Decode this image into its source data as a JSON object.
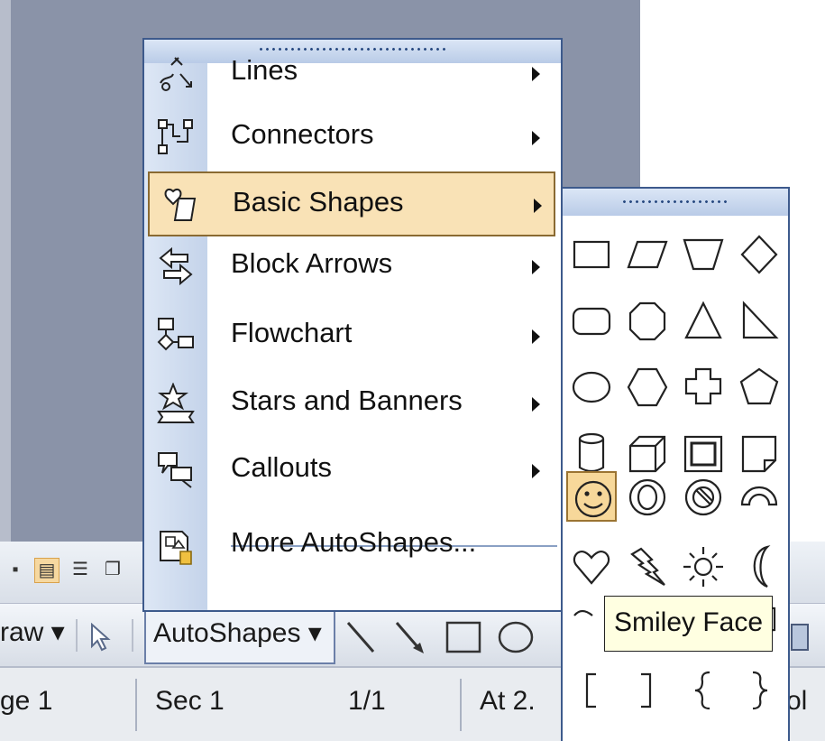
{
  "menu": {
    "items": [
      {
        "label": "Lines",
        "icon": "lines-icon",
        "has_submenu": true
      },
      {
        "label": "Connectors",
        "icon": "connectors-icon",
        "has_submenu": true
      },
      {
        "label": "Basic Shapes",
        "icon": "basic-shapes-icon",
        "has_submenu": true,
        "selected": true
      },
      {
        "label": "Block Arrows",
        "icon": "block-arrows-icon",
        "has_submenu": true
      },
      {
        "label": "Flowchart",
        "icon": "flowchart-icon",
        "has_submenu": true
      },
      {
        "label": "Stars and Banners",
        "icon": "stars-banners-icon",
        "has_submenu": true
      },
      {
        "label": "Callouts",
        "icon": "callouts-icon",
        "has_submenu": true
      },
      {
        "label": "More AutoShapes...",
        "icon": "more-autoshapes-icon",
        "has_submenu": false
      }
    ]
  },
  "submenu": {
    "title": "Basic Shapes",
    "shapes": [
      "rectangle",
      "parallelogram",
      "trapezoid",
      "diamond",
      "rounded-rectangle",
      "octagon",
      "isosceles-triangle",
      "right-triangle",
      "oval",
      "hexagon",
      "cross",
      "pentagon",
      "can",
      "cube",
      "bevel",
      "folded-corner",
      "smiley-face",
      "donut",
      "no-symbol",
      "block-arc",
      "heart",
      "lightning-bolt",
      "sun",
      "moon",
      "arc",
      "double-bracket",
      "double-brace",
      "plaque",
      "left-bracket",
      "right-bracket",
      "left-brace",
      "right-brace"
    ],
    "hovered": "smiley-face"
  },
  "tooltip": {
    "text": "Smiley Face"
  },
  "draw_toolbar": {
    "draw_label": "raw ▾",
    "autoshapes_label": "AutoShapes ▾"
  },
  "status_bar": {
    "page": "ge 1",
    "section": "Sec 1",
    "pages": "1/1",
    "at": "At 2.",
    "col": "ol"
  },
  "colors": {
    "menu_border": "#3d5a8c",
    "selection": "#f9e2b6",
    "rail": "#c4d3ea",
    "tooltip_bg": "#ffffe1"
  }
}
